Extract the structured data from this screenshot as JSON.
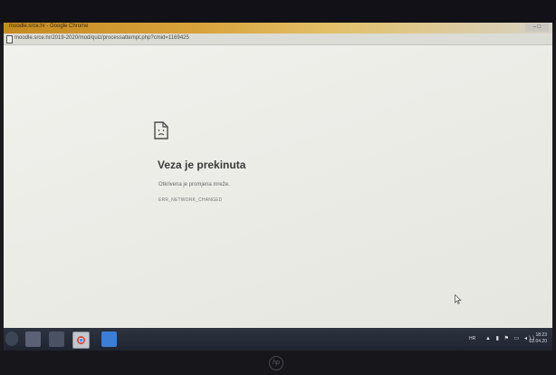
{
  "window": {
    "title": "moodle.srce.hr - Google Chrome",
    "controls": "– □",
    "url": "moodle.srce.hr/2019-2020/mod/quiz/processattempt.php?cmid=1169425"
  },
  "error_page": {
    "icon": "sad-document-icon",
    "title": "Veza je prekinuta",
    "description": "Otkrivena je promjena mreže.",
    "code": "ERR_NETWORK_CHANGED"
  },
  "taskbar": {
    "items": [
      "start-icon",
      "folder-icon",
      "media-icon",
      "chrome-icon",
      "app-icon"
    ],
    "tray": {
      "language": "HR",
      "icons": "▲ ▮ ⚑ ▭ ◂))",
      "time": "18:23",
      "date": "22.04.20"
    }
  },
  "bezel": {
    "logo": "hp"
  }
}
